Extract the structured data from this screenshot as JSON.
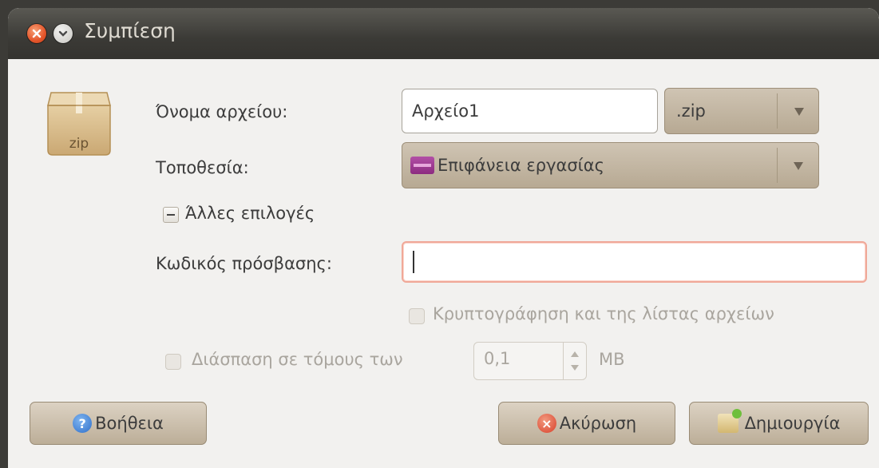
{
  "window": {
    "title": "Συμπίεση"
  },
  "icons": {
    "archive": "zip-box-icon",
    "archive_label": "zip",
    "close": "close-icon",
    "menu": "window-menu-icon",
    "folder": "desktop-folder-icon",
    "help": "help-icon",
    "cancel": "cancel-icon",
    "create": "create-archive-icon"
  },
  "form": {
    "filename_label": "Όνομα αρχείου:",
    "filename_value": "Αρχείο1",
    "extension_value": ".zip",
    "location_label": "Τοποθεσία:",
    "location_value": "Επιφάνεια εργασίας",
    "other_options_label": "Άλλες επιλογές",
    "password_label": "Κωδικός πρόσβασης:",
    "password_value": "",
    "encrypt_list_label": "Κρυπτογράφηση και της λίστας αρχείων",
    "split_label": "Διάσπαση σε τόμους των",
    "split_value": "0,1",
    "split_unit": "MB"
  },
  "buttons": {
    "help": "Βοήθεια",
    "cancel": "Ακύρωση",
    "create": "Δημιουργία"
  },
  "colors": {
    "titlebar": "#3c3b37",
    "dialog_bg": "#f2f1ef",
    "button_bg": "#c8bca9",
    "focus_border": "#f0a898"
  }
}
